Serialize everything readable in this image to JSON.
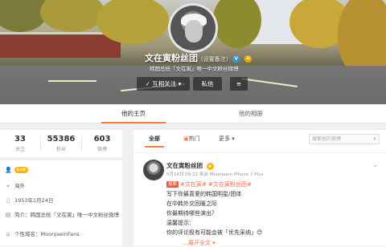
{
  "profile": {
    "name": "文在寅粉丝团",
    "name_tag": "(设置备注)",
    "bio": "韩国总统「文在寅」唯一中文粉丝微博",
    "buttons": {
      "follow": "互相关注",
      "message": "私信",
      "more": "≡"
    }
  },
  "page_tabs": [
    "他的主页",
    "他的相册"
  ],
  "stats": [
    {
      "value": "33",
      "label": "关注"
    },
    {
      "value": "55386",
      "label": "粉丝"
    },
    {
      "value": "603",
      "label": "微博"
    }
  ],
  "info": {
    "level": "Lv6",
    "location": "海外",
    "birthday": "1953年1月24日",
    "intro": "简介：韩国总统「文在寅」唯一中文粉丝微博",
    "domain": "个性域名：MoonJaeinFans"
  },
  "feed": {
    "tabs": [
      "全部",
      "热门",
      "更多"
    ],
    "search_placeholder": "搜索他的微博",
    "post": {
      "author": "文在寅粉丝团",
      "meta": "5月16日 09:21 来自 MoonJaein iPhone 7 Plus",
      "hot_label": "投票",
      "hashtags": "#文在寅# #文在寅粉丝团#",
      "lines": [
        "写下你最喜爱的韩国明星/团体",
        "在中韩外交回暖之际",
        "你最期待哪些演出？",
        "温馨提示：",
        "你的评论极有可能会被「优先采纳」😊"
      ],
      "expand": "展开全文"
    }
  },
  "colors": {
    "accent": "#fa7d3c",
    "link": "#eb7350",
    "level": "#ffb400"
  }
}
